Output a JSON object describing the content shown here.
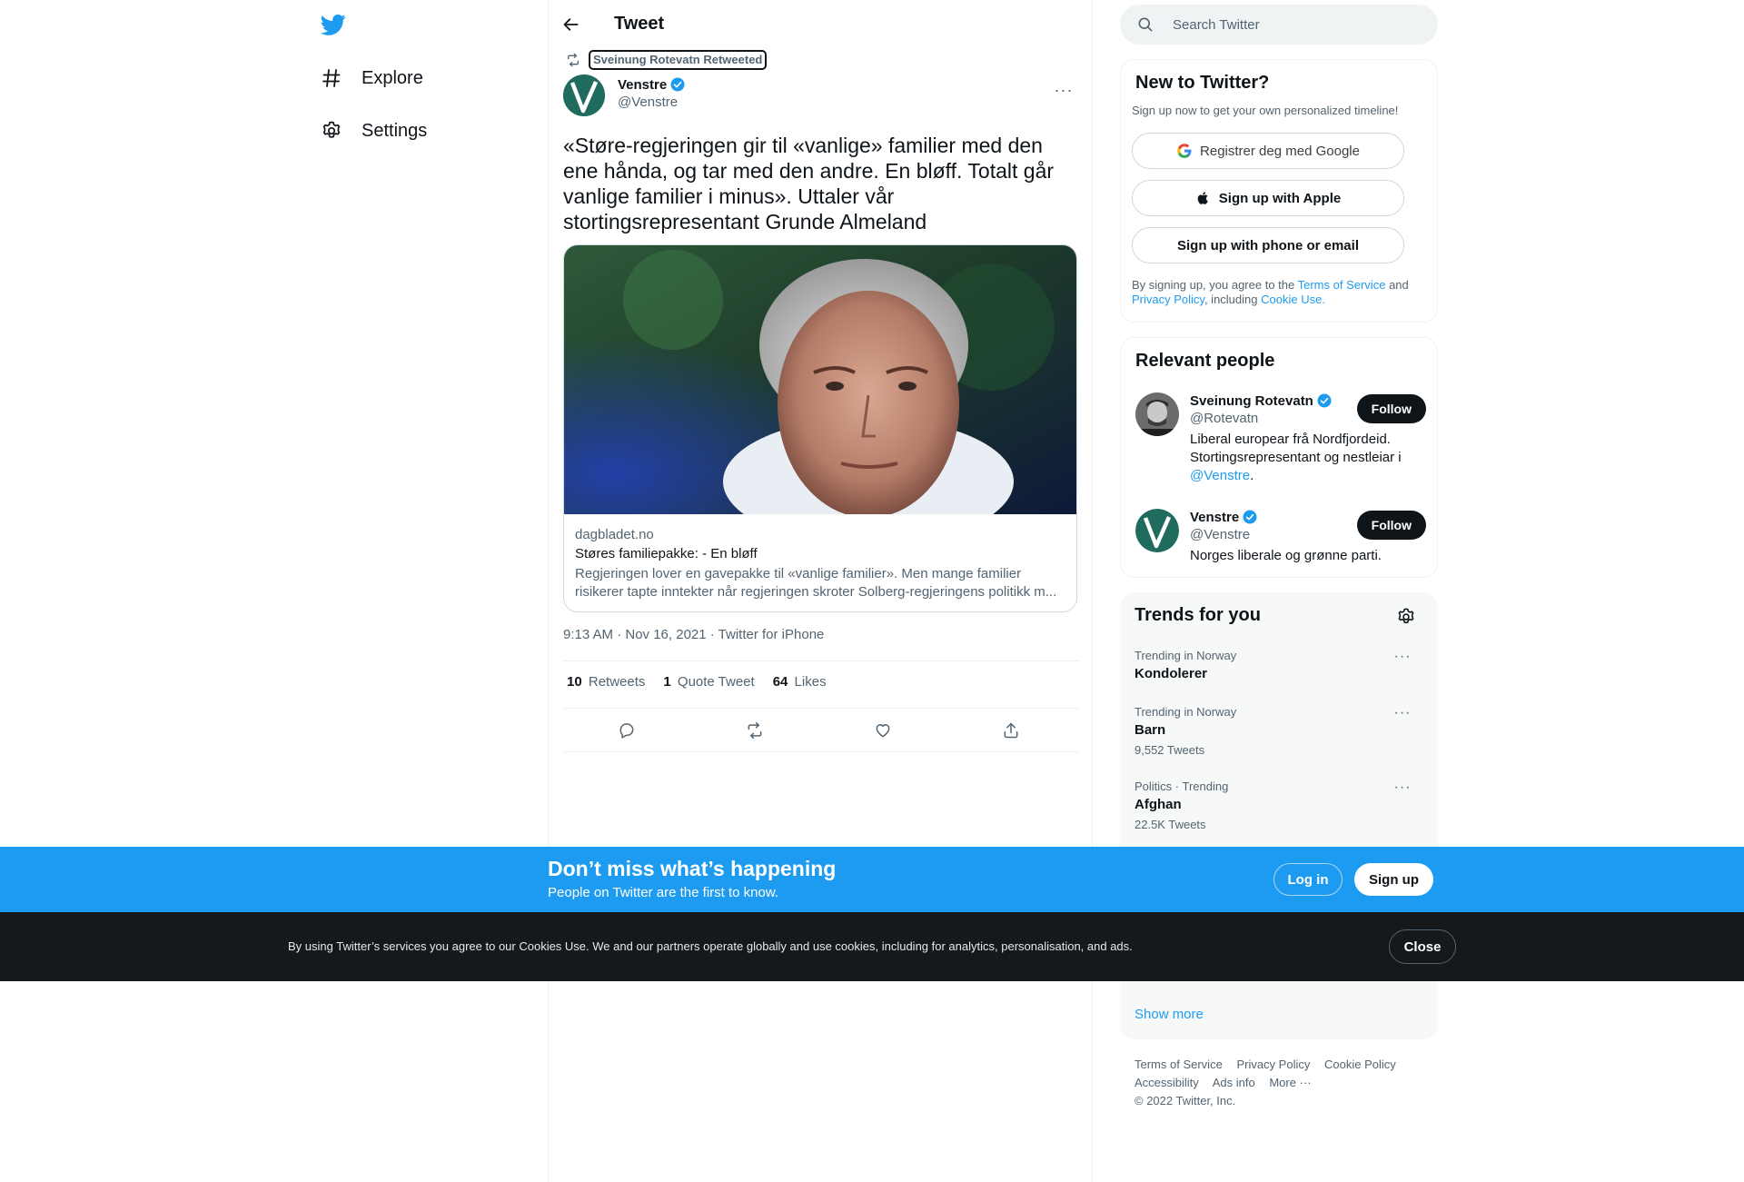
{
  "nav": {
    "items": [
      {
        "label": "Explore"
      },
      {
        "label": "Settings"
      }
    ]
  },
  "header": {
    "title": "Tweet"
  },
  "tweet": {
    "retweeted_by": "Sveinung Rotevatn Retweeted",
    "author_name": "Venstre",
    "author_handle": "@Venstre",
    "text": "«Støre-regjeringen gir til «vanlige» familier med den ene hånda, og tar med den andre. En bløff. Totalt går vanlige familier i minus». Uttaler vår stortingsrepresentant Grunde Almeland",
    "card": {
      "domain": "dagbladet.no",
      "title": "Støres familiepakke: - En bløff",
      "description": "Regjeringen lover en gavepakke til «vanlige familier». Men mange familier risikerer tapte inntekter når regjeringen skroter Solberg-regjeringens politikk m..."
    },
    "timestamp": "9:13 AM · Nov 16, 2021 · Twitter for iPhone",
    "stats": {
      "retweets_count": "10",
      "retweets_label": "Retweets",
      "quotes_count": "1",
      "quotes_label": "Quote Tweet",
      "likes_count": "64",
      "likes_label": "Likes"
    }
  },
  "search": {
    "placeholder": "Search Twitter"
  },
  "new_to_twitter": {
    "title": "New to Twitter?",
    "subtitle": "Sign up now to get your own personalized timeline!",
    "google_label": "Registrer deg med Google",
    "apple_label": "Sign up with Apple",
    "phone_label": "Sign up with phone or email",
    "legal_prefix": "By signing up, you agree to the",
    "terms_link": "Terms of Service",
    "legal_and": "and",
    "privacy_link": "Privacy Policy",
    "legal_including": ", including",
    "cookie_link": "Cookie Use."
  },
  "relevant_people": {
    "title": "Relevant people",
    "people": [
      {
        "name": "Sveinung Rotevatn",
        "handle": "@Rotevatn",
        "bio_text": "Liberal europear frå Nordfjordeid. Stortingsrepresentant og nestleiar i",
        "bio_link": "@Venstre",
        "bio_end": ".",
        "follow": "Follow"
      },
      {
        "name": "Venstre",
        "handle": "@Venstre",
        "bio_text": "Norges liberale og grønne parti.",
        "follow": "Follow"
      }
    ]
  },
  "trends": {
    "title": "Trends for you",
    "items": [
      {
        "meta": "Trending in Norway",
        "name": "Kondolerer",
        "count": ""
      },
      {
        "meta": "Trending in Norway",
        "name": "Barn",
        "count": "9,552 Tweets"
      },
      {
        "meta": "Politics · Trending",
        "name": "Afghan",
        "count": "22.5K Tweets"
      }
    ],
    "show_more": "Show more"
  },
  "footer": {
    "links": [
      "Terms of Service",
      "Privacy Policy",
      "Cookie Policy",
      "Accessibility",
      "Ads info",
      "More ···"
    ],
    "copyright": "© 2022 Twitter, Inc."
  },
  "banner": {
    "title": "Don’t miss what’s happening",
    "subtitle": "People on Twitter are the first to know.",
    "login": "Log in",
    "signup": "Sign up"
  },
  "cookie": {
    "text": "By using Twitter’s services you agree to our Cookies Use. We and our partners operate globally and use cookies, including for analytics, personalisation, and ads.",
    "close": "Close"
  },
  "colors": {
    "accent": "#1d9bf0",
    "text": "#0f1419",
    "secondary": "#536471",
    "venstre_green": "#1f6b5d",
    "cookie_bg": "#15191c"
  }
}
